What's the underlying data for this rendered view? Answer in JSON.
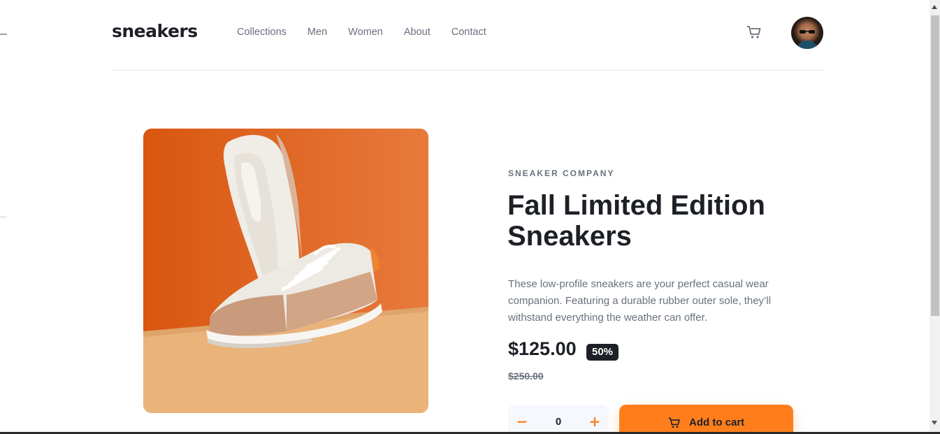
{
  "header": {
    "logo": "sneakers",
    "nav": [
      "Collections",
      "Men",
      "Women",
      "About",
      "Contact"
    ]
  },
  "product": {
    "company": "SNEAKER COMPANY",
    "title": "Fall Limited Edition Sneakers",
    "description": "These low-profile sneakers are your perfect casual wear companion. Featuring a durable rubber outer sole, they’ll withstand everything the weather can offer.",
    "price": "$125.00",
    "discount": "50%",
    "old_price": "$250.00"
  },
  "cart_controls": {
    "minus": "−",
    "quantity": "0",
    "plus": "+",
    "add_label": "Add to cart"
  },
  "colors": {
    "accent": "#ff7e1b",
    "dark": "#1d2026",
    "text_grey": "#69707d"
  },
  "icons": {
    "cart": "cart-icon",
    "avatar": "avatar"
  }
}
